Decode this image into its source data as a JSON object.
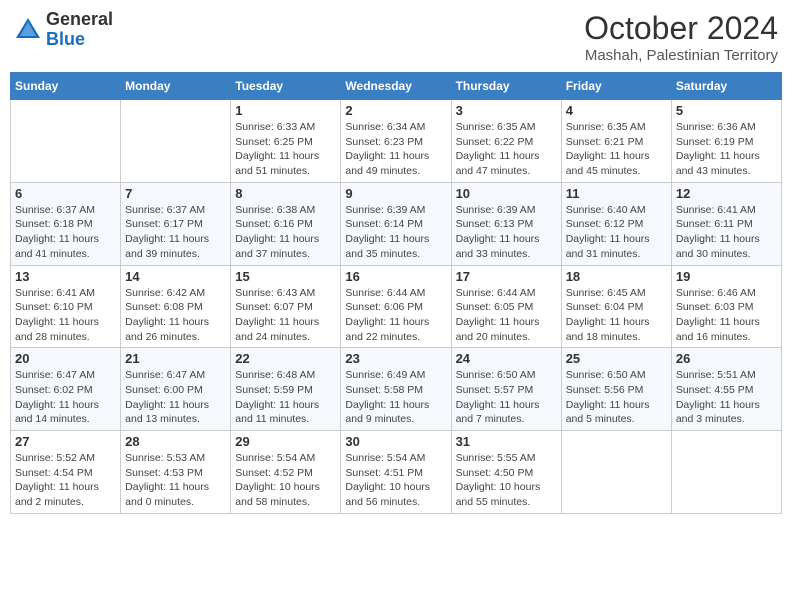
{
  "logo": {
    "general": "General",
    "blue": "Blue"
  },
  "header": {
    "month": "October 2024",
    "location": "Mashah, Palestinian Territory"
  },
  "weekdays": [
    "Sunday",
    "Monday",
    "Tuesday",
    "Wednesday",
    "Thursday",
    "Friday",
    "Saturday"
  ],
  "weeks": [
    [
      {
        "day": "",
        "info": ""
      },
      {
        "day": "",
        "info": ""
      },
      {
        "day": "1",
        "info": "Sunrise: 6:33 AM\nSunset: 6:25 PM\nDaylight: 11 hours and 51 minutes."
      },
      {
        "day": "2",
        "info": "Sunrise: 6:34 AM\nSunset: 6:23 PM\nDaylight: 11 hours and 49 minutes."
      },
      {
        "day": "3",
        "info": "Sunrise: 6:35 AM\nSunset: 6:22 PM\nDaylight: 11 hours and 47 minutes."
      },
      {
        "day": "4",
        "info": "Sunrise: 6:35 AM\nSunset: 6:21 PM\nDaylight: 11 hours and 45 minutes."
      },
      {
        "day": "5",
        "info": "Sunrise: 6:36 AM\nSunset: 6:19 PM\nDaylight: 11 hours and 43 minutes."
      }
    ],
    [
      {
        "day": "6",
        "info": "Sunrise: 6:37 AM\nSunset: 6:18 PM\nDaylight: 11 hours and 41 minutes."
      },
      {
        "day": "7",
        "info": "Sunrise: 6:37 AM\nSunset: 6:17 PM\nDaylight: 11 hours and 39 minutes."
      },
      {
        "day": "8",
        "info": "Sunrise: 6:38 AM\nSunset: 6:16 PM\nDaylight: 11 hours and 37 minutes."
      },
      {
        "day": "9",
        "info": "Sunrise: 6:39 AM\nSunset: 6:14 PM\nDaylight: 11 hours and 35 minutes."
      },
      {
        "day": "10",
        "info": "Sunrise: 6:39 AM\nSunset: 6:13 PM\nDaylight: 11 hours and 33 minutes."
      },
      {
        "day": "11",
        "info": "Sunrise: 6:40 AM\nSunset: 6:12 PM\nDaylight: 11 hours and 31 minutes."
      },
      {
        "day": "12",
        "info": "Sunrise: 6:41 AM\nSunset: 6:11 PM\nDaylight: 11 hours and 30 minutes."
      }
    ],
    [
      {
        "day": "13",
        "info": "Sunrise: 6:41 AM\nSunset: 6:10 PM\nDaylight: 11 hours and 28 minutes."
      },
      {
        "day": "14",
        "info": "Sunrise: 6:42 AM\nSunset: 6:08 PM\nDaylight: 11 hours and 26 minutes."
      },
      {
        "day": "15",
        "info": "Sunrise: 6:43 AM\nSunset: 6:07 PM\nDaylight: 11 hours and 24 minutes."
      },
      {
        "day": "16",
        "info": "Sunrise: 6:44 AM\nSunset: 6:06 PM\nDaylight: 11 hours and 22 minutes."
      },
      {
        "day": "17",
        "info": "Sunrise: 6:44 AM\nSunset: 6:05 PM\nDaylight: 11 hours and 20 minutes."
      },
      {
        "day": "18",
        "info": "Sunrise: 6:45 AM\nSunset: 6:04 PM\nDaylight: 11 hours and 18 minutes."
      },
      {
        "day": "19",
        "info": "Sunrise: 6:46 AM\nSunset: 6:03 PM\nDaylight: 11 hours and 16 minutes."
      }
    ],
    [
      {
        "day": "20",
        "info": "Sunrise: 6:47 AM\nSunset: 6:02 PM\nDaylight: 11 hours and 14 minutes."
      },
      {
        "day": "21",
        "info": "Sunrise: 6:47 AM\nSunset: 6:00 PM\nDaylight: 11 hours and 13 minutes."
      },
      {
        "day": "22",
        "info": "Sunrise: 6:48 AM\nSunset: 5:59 PM\nDaylight: 11 hours and 11 minutes."
      },
      {
        "day": "23",
        "info": "Sunrise: 6:49 AM\nSunset: 5:58 PM\nDaylight: 11 hours and 9 minutes."
      },
      {
        "day": "24",
        "info": "Sunrise: 6:50 AM\nSunset: 5:57 PM\nDaylight: 11 hours and 7 minutes."
      },
      {
        "day": "25",
        "info": "Sunrise: 6:50 AM\nSunset: 5:56 PM\nDaylight: 11 hours and 5 minutes."
      },
      {
        "day": "26",
        "info": "Sunrise: 5:51 AM\nSunset: 4:55 PM\nDaylight: 11 hours and 3 minutes."
      }
    ],
    [
      {
        "day": "27",
        "info": "Sunrise: 5:52 AM\nSunset: 4:54 PM\nDaylight: 11 hours and 2 minutes."
      },
      {
        "day": "28",
        "info": "Sunrise: 5:53 AM\nSunset: 4:53 PM\nDaylight: 11 hours and 0 minutes."
      },
      {
        "day": "29",
        "info": "Sunrise: 5:54 AM\nSunset: 4:52 PM\nDaylight: 10 hours and 58 minutes."
      },
      {
        "day": "30",
        "info": "Sunrise: 5:54 AM\nSunset: 4:51 PM\nDaylight: 10 hours and 56 minutes."
      },
      {
        "day": "31",
        "info": "Sunrise: 5:55 AM\nSunset: 4:50 PM\nDaylight: 10 hours and 55 minutes."
      },
      {
        "day": "",
        "info": ""
      },
      {
        "day": "",
        "info": ""
      }
    ]
  ]
}
